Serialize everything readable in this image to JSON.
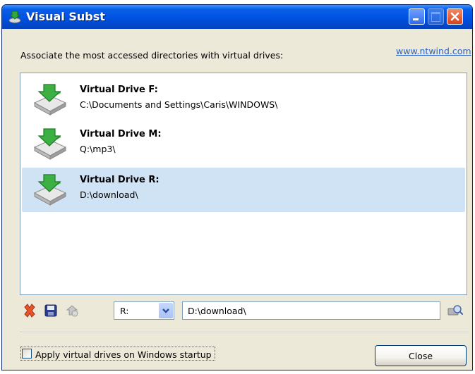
{
  "window": {
    "title": "Visual Subst",
    "buttons": [
      "minimize",
      "maximize",
      "close"
    ]
  },
  "header": {
    "description": "Associate the most accessed directories with virtual drives:",
    "link": "www.ntwind.com"
  },
  "drives": [
    {
      "name": "Virtual Drive F:",
      "path": "C:\\Documents and Settings\\Caris\\WINDOWS\\",
      "selected": false,
      "icon": "drive-icon"
    },
    {
      "name": "Virtual Drive M:",
      "path": "Q:\\mp3\\",
      "selected": false,
      "icon": "drive-icon"
    },
    {
      "name": "Virtual Drive R:",
      "path": "D:\\download\\",
      "selected": true,
      "icon": "drive-icon"
    }
  ],
  "toolbar": {
    "icons": [
      "remove-icon",
      "save-icon",
      "apply-icon"
    ],
    "drive_letter": "R:",
    "path_value": "D:\\download\\",
    "browse_icon": "browse-folder-icon"
  },
  "footer": {
    "startup_label": "Apply virtual drives on Windows startup",
    "startup_checked": false,
    "close_label": "Close"
  },
  "colors": {
    "titlebar": "#0054e3",
    "selection": "#cfe3f5",
    "link": "#2b62c4",
    "window_bg": "#ece9d8"
  }
}
